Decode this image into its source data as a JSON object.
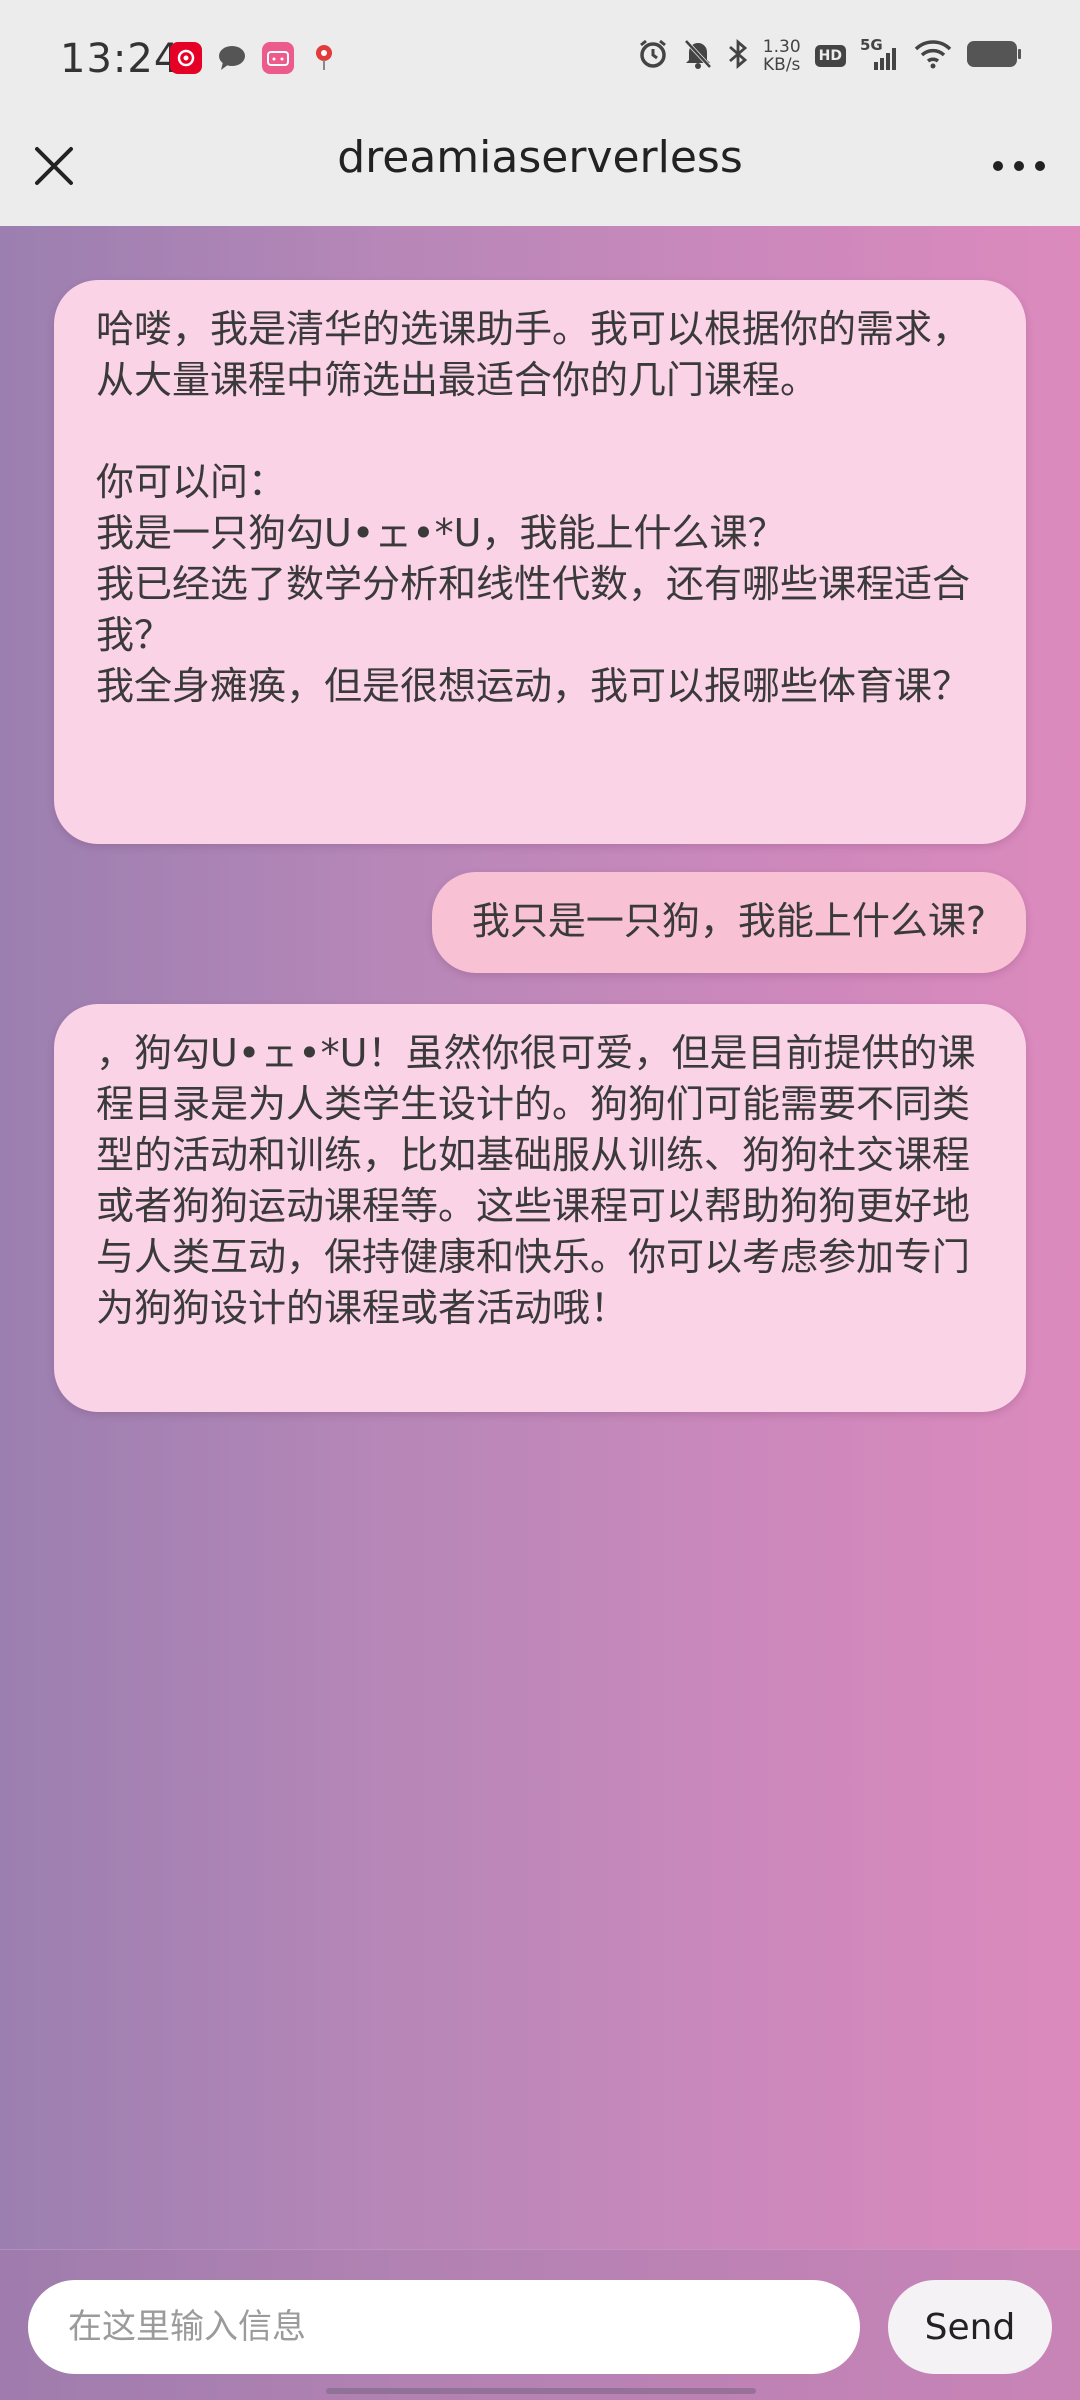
{
  "status_bar": {
    "time": "13:24",
    "net_speed_value": "1.30",
    "net_speed_unit": "KB/s",
    "hd_label": "HD",
    "signal_label": "5G",
    "icons": [
      "netease-music-icon",
      "message-icon",
      "bilibili-icon",
      "map-pin-icon",
      "alarm-icon",
      "mute-icon",
      "bluetooth-icon",
      "signal-icon",
      "wifi-icon",
      "battery-icon"
    ]
  },
  "header": {
    "title": "dreamiaserverless",
    "close_icon": "close-icon",
    "more_icon": "more-icon"
  },
  "messages": [
    {
      "role": "assistant",
      "text": "哈喽，我是清华的选课助手。我可以根据你的需求，从大量课程中筛选出最适合你的几门课程。\n\n你可以问：\n我是一只狗勾U•ェ•*U，我能上什么课？\n我已经选了数学分析和线性代数，还有哪些课程适合我？\n我全身瘫痪，但是很想运动，我可以报哪些体育课？"
    },
    {
      "role": "user",
      "text": "我只是一只狗，我能上什么课?"
    },
    {
      "role": "assistant",
      "text": "，狗勾U•ェ•*U！虽然你很可爱，但是目前提供的课程目录是为人类学生设计的。狗狗们可能需要不同类型的活动和训练，比如基础服从训练、狗狗社交课程或者狗狗运动课程等。这些课程可以帮助狗狗更好地与人类互动，保持健康和快乐。你可以考虑参加专门为狗狗设计的课程或者活动哦！"
    }
  ],
  "composer": {
    "placeholder": "在这里输入信息",
    "value": "",
    "send_label": "Send"
  },
  "colors": {
    "bar_background": "#ececec",
    "bubble_assistant": "#fbd3e7",
    "bubble_user": "#f8c2d4",
    "gradient_left": "#9b7fb0",
    "gradient_right": "#dc8abd"
  }
}
